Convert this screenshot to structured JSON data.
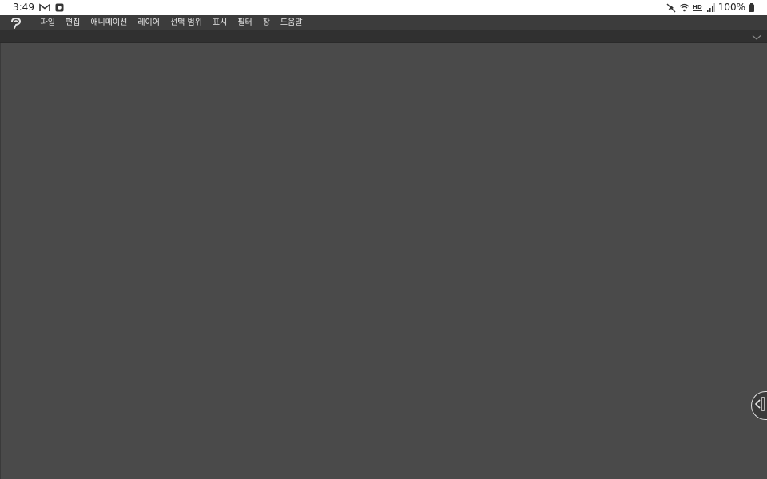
{
  "status_bar": {
    "time": "3:49",
    "left_icons": [
      "gmail-icon",
      "app-notification-icon"
    ],
    "right_icons": [
      "mute-icon",
      "wifi-icon",
      "hd-voice-icon",
      "signal-icon"
    ],
    "battery_text": "100%"
  },
  "menu": {
    "logo_icon": "clip-studio-logo-icon",
    "items": [
      "파일",
      "편집",
      "애니메이션",
      "레이어",
      "선택 범위",
      "표시",
      "필터",
      "창",
      "도움말"
    ]
  },
  "toolbar": {
    "collapse_icon": "chevron-down-icon"
  },
  "side_panel_handle": {
    "icon": "chevron-left-icon"
  },
  "colors": {
    "status_bg": "#ffffff",
    "menu_bg": "#3c3c3c",
    "toolbar_bg": "#303030",
    "canvas_bg": "#4a4a4a",
    "menu_text": "#e8e8e8"
  }
}
